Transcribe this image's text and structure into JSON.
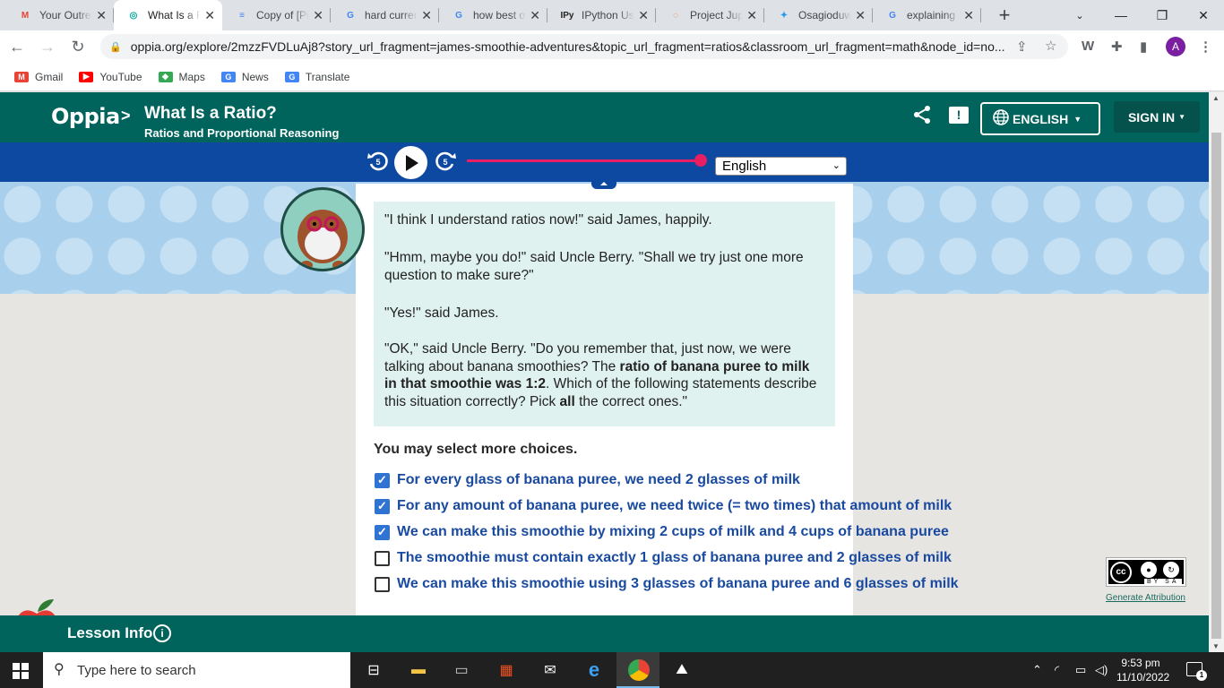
{
  "browser": {
    "tabs": [
      {
        "title": "Your Outreach",
        "icon": "gmail-icon",
        "fav": "M",
        "favcolor": "#ea4335",
        "active": false
      },
      {
        "title": "What Is a Ratio?",
        "icon": "oppia-icon",
        "fav": "◎",
        "favcolor": "#00a99d",
        "active": true
      },
      {
        "title": "Copy of [Pi",
        "icon": "docs-icon",
        "fav": "≡",
        "favcolor": "#4285f4",
        "active": false
      },
      {
        "title": "hard currency",
        "icon": "google-icon",
        "fav": "G",
        "favcolor": "#4285f4",
        "active": false
      },
      {
        "title": "how best o",
        "icon": "google-icon",
        "fav": "G",
        "favcolor": "#4285f4",
        "active": false
      },
      {
        "title": "IPython Us",
        "icon": "ipython-icon",
        "fav": "IPy",
        "favcolor": "#222",
        "active": false
      },
      {
        "title": "Project Jup",
        "icon": "jupyter-icon",
        "fav": "◌",
        "favcolor": "#f37726",
        "active": false
      },
      {
        "title": "Osagioduw",
        "icon": "twitter-icon",
        "fav": "✦",
        "favcolor": "#1d9bf0",
        "active": false
      },
      {
        "title": "explaining",
        "icon": "google-icon",
        "fav": "G",
        "favcolor": "#4285f4",
        "active": false
      }
    ],
    "url": "oppia.org/explore/2mzzFVDLuAj8?story_url_fragment=james-smoothie-adventures&topic_url_fragment=ratios&classroom_url_fragment=math&node_id=no...",
    "profile_initial": "A",
    "bookmarks": [
      {
        "label": "Gmail",
        "icon": "gmail-icon",
        "glyph": "M",
        "color": "#ea4335"
      },
      {
        "label": "YouTube",
        "icon": "youtube-icon",
        "glyph": "▶",
        "color": "#ff0000"
      },
      {
        "label": "Maps",
        "icon": "maps-icon",
        "glyph": "◆",
        "color": "#34a853"
      },
      {
        "label": "News",
        "icon": "news-icon",
        "glyph": "G",
        "color": "#4285f4"
      },
      {
        "label": "Translate",
        "icon": "translate-icon",
        "glyph": "G",
        "color": "#4285f4"
      }
    ]
  },
  "header": {
    "logo": "Oppia",
    "separator": ">",
    "lesson_title": "What Is a Ratio?",
    "topic": "Ratios and Proportional Reasoning",
    "language": "ENGLISH",
    "sign_in": "SIGN IN"
  },
  "audio": {
    "rewind_label": "5",
    "forward_label": "5",
    "language": "English",
    "progress": 1.0
  },
  "content": {
    "paragraphs": [
      "\"I think I understand ratios now!\" said James, happily.",
      "\"Hmm, maybe you do!\" said Uncle Berry. \"Shall we try just one more question to make sure?\"",
      "\"Yes!\" said James."
    ],
    "last_paragraph": {
      "pre": "\"OK,\" said Uncle Berry. \"Do you remember that, just now, we were talking about banana smoothies? The ",
      "bold1": "ratio of banana puree to milk in that smoothie was 1:2",
      "mid": ". Which of the following statements describe this situation correctly? Pick ",
      "bold2": "all",
      "post": " the correct ones.\""
    },
    "prompt": "You may select more choices.",
    "choices": [
      {
        "text": "For every glass of banana puree, we need 2 glasses of milk",
        "checked": true
      },
      {
        "text": "For any amount of banana puree, we need twice (= two times) that amount of milk",
        "checked": true
      },
      {
        "text": "We can make this smoothie by mixing 2 cups of milk and 4 cups of banana puree",
        "checked": true
      },
      {
        "text": "The smoothie must contain exactly 1 glass of banana puree and 2 glasses of milk",
        "checked": false
      },
      {
        "text": "We can make this smoothie using 3 glasses of banana puree and 6 glasses of milk",
        "checked": false
      }
    ]
  },
  "footer": {
    "lesson_info": "Lesson Info",
    "license": {
      "by": "BY",
      "sa": "SA",
      "cc": "cc"
    },
    "generate_attribution": "Generate Attribution"
  },
  "taskbar": {
    "search_placeholder": "Type here to search",
    "time": "9:53 pm",
    "date": "11/10/2022",
    "notifications": "1"
  },
  "colors": {
    "oppia_green": "#00645c",
    "audio_blue": "#0d48a1",
    "choice_blue": "#1a4aa0",
    "checkbox_blue": "#2f73d3",
    "progress_pink": "#e91e63"
  }
}
